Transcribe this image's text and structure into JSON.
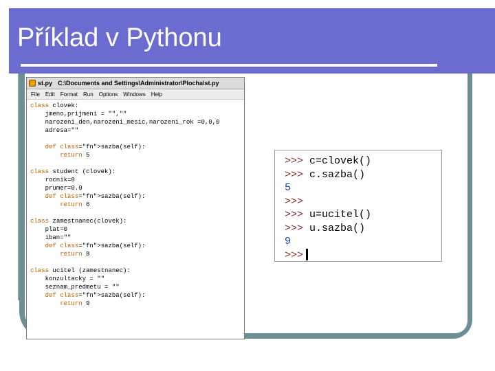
{
  "slide": {
    "title": "Příklad v Pythonu"
  },
  "editor": {
    "file_name": "st.py",
    "path": "C:\\Documents and Settings\\Administrator\\Plocha\\st.py",
    "menu": [
      "File",
      "Edit",
      "Format",
      "Run",
      "Options",
      "Windows",
      "Help"
    ],
    "code_lines": [
      "class clovek:",
      "    jmeno,prijmeni = \"\",\"\"",
      "    narozeni_den,narozeni_mesic,narozeni_rok =0,0,0",
      "    adresa=\"\"",
      "",
      "    def sazba(self):",
      "        return 5",
      "",
      "class student (clovek):",
      "    rocnik=0",
      "    prumer=0.0",
      "    def sazba(self):",
      "        return 6",
      "",
      "class zamestnanec(clovek):",
      "    plat=0",
      "    iban=\"\"",
      "    def sazba(self):",
      "        return 8",
      "",
      "class ucitel (zamestnanec):",
      "    konzultacky = \"\"",
      "    seznam_predmetu = \"\"",
      "    def sazba(self):",
      "        return 9"
    ]
  },
  "shell": {
    "prompt": ">>>",
    "lines": [
      {
        "prompt": ">>>",
        "text": "c=clovek()"
      },
      {
        "prompt": ">>>",
        "text": "c.sazba()"
      },
      {
        "output": "5"
      },
      {
        "prompt": ">>>",
        "text": ""
      },
      {
        "prompt": ">>>",
        "text": "u=ucitel()"
      },
      {
        "prompt": ">>>",
        "text": "u.sazba()"
      },
      {
        "output": "9"
      },
      {
        "prompt": ">>>",
        "text": "",
        "cursor": true
      }
    ]
  },
  "colors": {
    "title_bar": "#6b6bd0",
    "frame": "#6d8f94",
    "keyword": "#c06000",
    "function_name": "#0000c0",
    "shell_output": "#1a3fb0"
  }
}
